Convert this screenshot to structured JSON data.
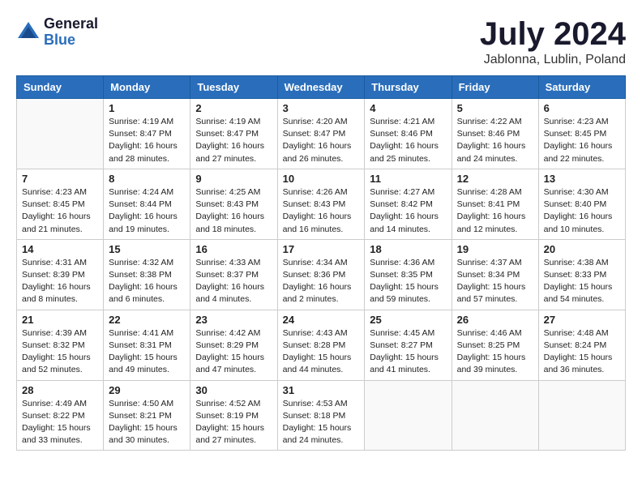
{
  "header": {
    "logo_general": "General",
    "logo_blue": "Blue",
    "month_title": "July 2024",
    "location": "Jablonna, Lublin, Poland"
  },
  "days_of_week": [
    "Sunday",
    "Monday",
    "Tuesday",
    "Wednesday",
    "Thursday",
    "Friday",
    "Saturday"
  ],
  "weeks": [
    [
      {
        "day": "",
        "info": ""
      },
      {
        "day": "1",
        "info": "Sunrise: 4:19 AM\nSunset: 8:47 PM\nDaylight: 16 hours\nand 28 minutes."
      },
      {
        "day": "2",
        "info": "Sunrise: 4:19 AM\nSunset: 8:47 PM\nDaylight: 16 hours\nand 27 minutes."
      },
      {
        "day": "3",
        "info": "Sunrise: 4:20 AM\nSunset: 8:47 PM\nDaylight: 16 hours\nand 26 minutes."
      },
      {
        "day": "4",
        "info": "Sunrise: 4:21 AM\nSunset: 8:46 PM\nDaylight: 16 hours\nand 25 minutes."
      },
      {
        "day": "5",
        "info": "Sunrise: 4:22 AM\nSunset: 8:46 PM\nDaylight: 16 hours\nand 24 minutes."
      },
      {
        "day": "6",
        "info": "Sunrise: 4:23 AM\nSunset: 8:45 PM\nDaylight: 16 hours\nand 22 minutes."
      }
    ],
    [
      {
        "day": "7",
        "info": "Sunrise: 4:23 AM\nSunset: 8:45 PM\nDaylight: 16 hours\nand 21 minutes."
      },
      {
        "day": "8",
        "info": "Sunrise: 4:24 AM\nSunset: 8:44 PM\nDaylight: 16 hours\nand 19 minutes."
      },
      {
        "day": "9",
        "info": "Sunrise: 4:25 AM\nSunset: 8:43 PM\nDaylight: 16 hours\nand 18 minutes."
      },
      {
        "day": "10",
        "info": "Sunrise: 4:26 AM\nSunset: 8:43 PM\nDaylight: 16 hours\nand 16 minutes."
      },
      {
        "day": "11",
        "info": "Sunrise: 4:27 AM\nSunset: 8:42 PM\nDaylight: 16 hours\nand 14 minutes."
      },
      {
        "day": "12",
        "info": "Sunrise: 4:28 AM\nSunset: 8:41 PM\nDaylight: 16 hours\nand 12 minutes."
      },
      {
        "day": "13",
        "info": "Sunrise: 4:30 AM\nSunset: 8:40 PM\nDaylight: 16 hours\nand 10 minutes."
      }
    ],
    [
      {
        "day": "14",
        "info": "Sunrise: 4:31 AM\nSunset: 8:39 PM\nDaylight: 16 hours\nand 8 minutes."
      },
      {
        "day": "15",
        "info": "Sunrise: 4:32 AM\nSunset: 8:38 PM\nDaylight: 16 hours\nand 6 minutes."
      },
      {
        "day": "16",
        "info": "Sunrise: 4:33 AM\nSunset: 8:37 PM\nDaylight: 16 hours\nand 4 minutes."
      },
      {
        "day": "17",
        "info": "Sunrise: 4:34 AM\nSunset: 8:36 PM\nDaylight: 16 hours\nand 2 minutes."
      },
      {
        "day": "18",
        "info": "Sunrise: 4:36 AM\nSunset: 8:35 PM\nDaylight: 15 hours\nand 59 minutes."
      },
      {
        "day": "19",
        "info": "Sunrise: 4:37 AM\nSunset: 8:34 PM\nDaylight: 15 hours\nand 57 minutes."
      },
      {
        "day": "20",
        "info": "Sunrise: 4:38 AM\nSunset: 8:33 PM\nDaylight: 15 hours\nand 54 minutes."
      }
    ],
    [
      {
        "day": "21",
        "info": "Sunrise: 4:39 AM\nSunset: 8:32 PM\nDaylight: 15 hours\nand 52 minutes."
      },
      {
        "day": "22",
        "info": "Sunrise: 4:41 AM\nSunset: 8:31 PM\nDaylight: 15 hours\nand 49 minutes."
      },
      {
        "day": "23",
        "info": "Sunrise: 4:42 AM\nSunset: 8:29 PM\nDaylight: 15 hours\nand 47 minutes."
      },
      {
        "day": "24",
        "info": "Sunrise: 4:43 AM\nSunset: 8:28 PM\nDaylight: 15 hours\nand 44 minutes."
      },
      {
        "day": "25",
        "info": "Sunrise: 4:45 AM\nSunset: 8:27 PM\nDaylight: 15 hours\nand 41 minutes."
      },
      {
        "day": "26",
        "info": "Sunrise: 4:46 AM\nSunset: 8:25 PM\nDaylight: 15 hours\nand 39 minutes."
      },
      {
        "day": "27",
        "info": "Sunrise: 4:48 AM\nSunset: 8:24 PM\nDaylight: 15 hours\nand 36 minutes."
      }
    ],
    [
      {
        "day": "28",
        "info": "Sunrise: 4:49 AM\nSunset: 8:22 PM\nDaylight: 15 hours\nand 33 minutes."
      },
      {
        "day": "29",
        "info": "Sunrise: 4:50 AM\nSunset: 8:21 PM\nDaylight: 15 hours\nand 30 minutes."
      },
      {
        "day": "30",
        "info": "Sunrise: 4:52 AM\nSunset: 8:19 PM\nDaylight: 15 hours\nand 27 minutes."
      },
      {
        "day": "31",
        "info": "Sunrise: 4:53 AM\nSunset: 8:18 PM\nDaylight: 15 hours\nand 24 minutes."
      },
      {
        "day": "",
        "info": ""
      },
      {
        "day": "",
        "info": ""
      },
      {
        "day": "",
        "info": ""
      }
    ]
  ]
}
